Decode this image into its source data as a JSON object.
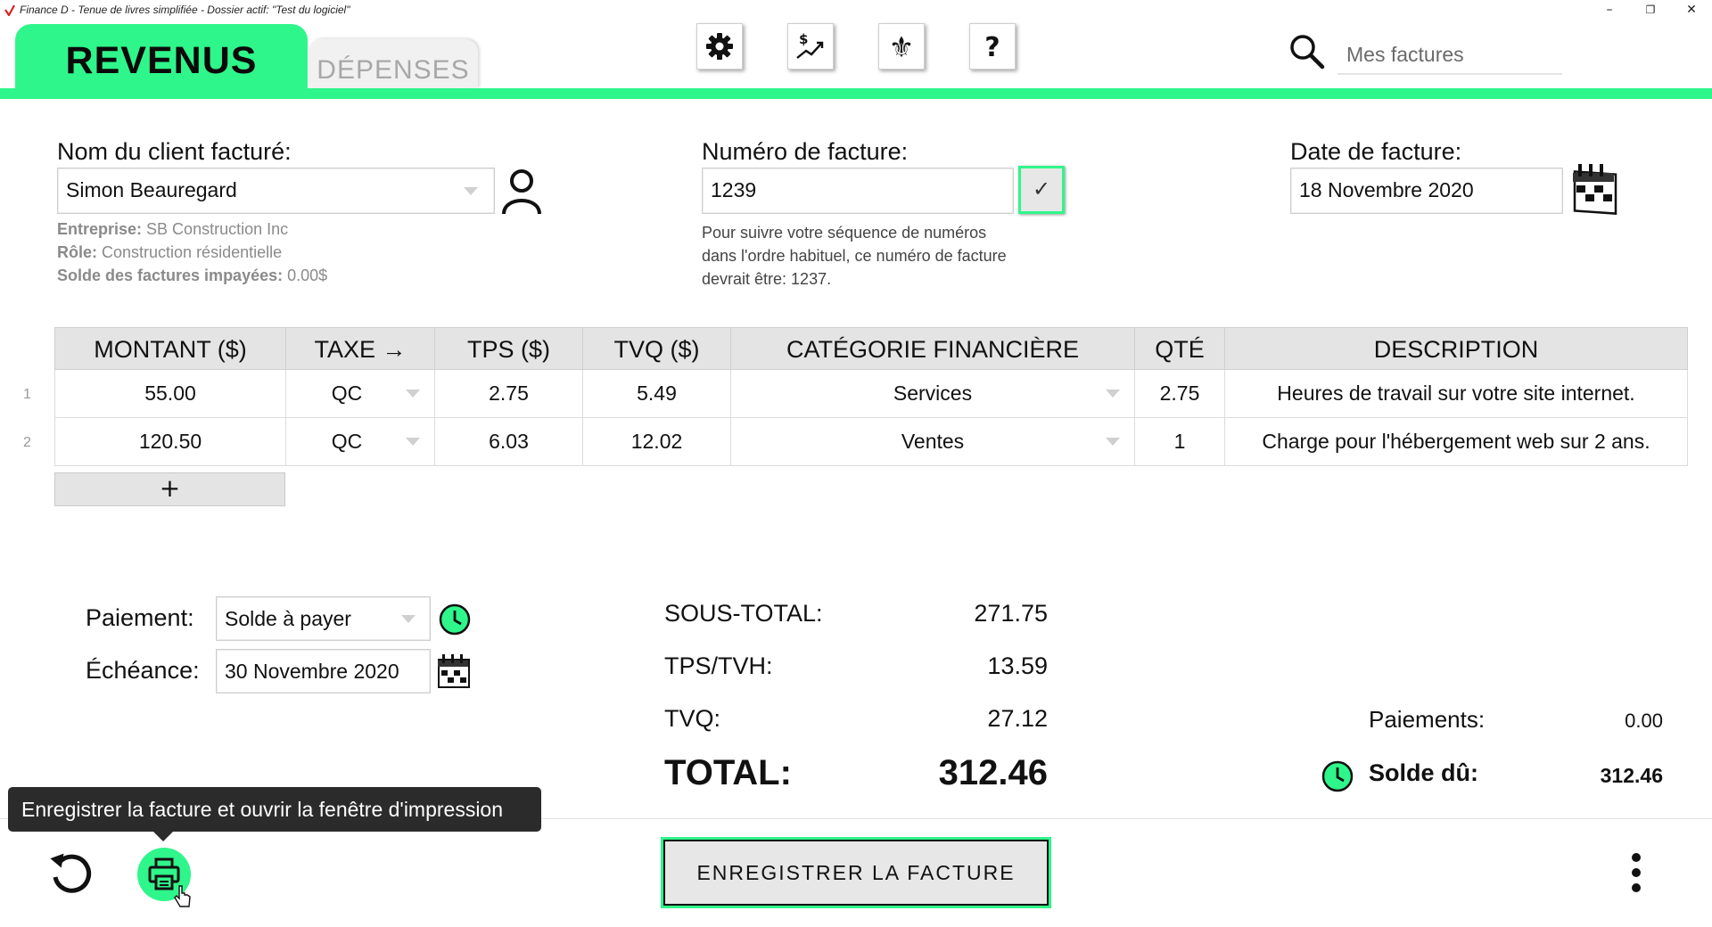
{
  "window": {
    "title": "Finance D - Tenue de livres simplifiée - Dossier actif: \"Test du logiciel\"",
    "minimize": "–",
    "restore": "❐",
    "close": "✕"
  },
  "header": {
    "tab_revenus": "REVENUS",
    "tab_depenses": "DÉPENSES",
    "search_placeholder": "Mes factures",
    "accent_color": "#2ff68a"
  },
  "client": {
    "label": "Nom du client facturé:",
    "value": "Simon Beauregard",
    "company_label": "Entreprise:",
    "company": "SB Construction Inc",
    "role_label": "Rôle:",
    "role": "Construction résidentielle",
    "unpaid_label": "Solde des factures impayées:",
    "unpaid": "0.00$"
  },
  "invoice": {
    "number_label": "Numéro de facture:",
    "number": "1239",
    "check": "✓",
    "hint": "Pour suivre votre séquence de numéros dans l'ordre habituel, ce numéro de facture devrait être: 1237.",
    "date_label": "Date de facture:",
    "date": "18 Novembre 2020"
  },
  "table": {
    "headers": [
      "MONTANT ($)",
      "TAXE →",
      "TPS ($)",
      "TVQ ($)",
      "CATÉGORIE FINANCIÈRE",
      "QTÉ",
      "DESCRIPTION"
    ],
    "rows": [
      {
        "num": "1",
        "montant": "55.00",
        "taxe": "QC",
        "tps": "2.75",
        "tvq": "5.49",
        "categorie": "Services",
        "qte": "2.75",
        "description": "Heures de travail sur votre site internet."
      },
      {
        "num": "2",
        "montant": "120.50",
        "taxe": "QC",
        "tps": "6.03",
        "tvq": "12.02",
        "categorie": "Ventes",
        "qte": "1",
        "description": "Charge pour l'hébergement web sur 2 ans."
      }
    ],
    "add_label": "+"
  },
  "payment": {
    "label": "Paiement:",
    "value": "Solde à payer",
    "due_label": "Échéance:",
    "due": "30 Novembre 2020"
  },
  "totals": {
    "subtotal_label": "SOUS-TOTAL:",
    "subtotal": "271.75",
    "tps_label": "TPS/TVH:",
    "tps": "13.59",
    "tvq_label": "TVQ:",
    "tvq": "27.12",
    "total_label": "TOTAL:",
    "total": "312.46",
    "payments_label": "Paiements:",
    "payments": "0.00",
    "balance_label": "Solde dû:",
    "balance": "312.46"
  },
  "footer": {
    "tooltip": "Enregistrer la facture et ouvrir la fenêtre d'impression",
    "save_label": "ENREGISTRER LA FACTURE"
  }
}
